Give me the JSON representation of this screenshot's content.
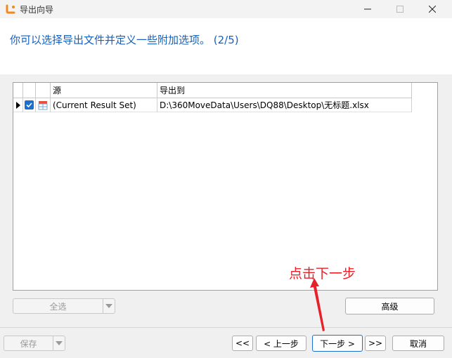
{
  "window": {
    "title": "导出向导",
    "headline": "你可以选择导出文件并定义一些附加选项。 (2/5)"
  },
  "grid": {
    "columns": [
      "源",
      "导出到"
    ],
    "rows": [
      {
        "source": "(Current Result Set)",
        "destination": "D:\\360MoveData\\Users\\DQ88\\Desktop\\无标题.xlsx",
        "checked": true
      }
    ]
  },
  "buttons": {
    "select_all": "全选",
    "advanced": "高级",
    "save": "保存",
    "first": "<<",
    "prev": "< 上一步",
    "next": "下一步 >",
    "last": ">>",
    "cancel": "取消"
  },
  "annotation": {
    "text": "点击下一步",
    "color": "#e8202a"
  },
  "colors": {
    "headline": "#1560bd",
    "checkbox": "#1a6fd0",
    "app_icon": "#f08a1c"
  },
  "icons": [
    "app-icon",
    "minimize-icon",
    "maximize-icon",
    "close-icon",
    "row-pointer-icon",
    "checkbox-icon",
    "table-icon",
    "dropdown-arrow-icon"
  ]
}
